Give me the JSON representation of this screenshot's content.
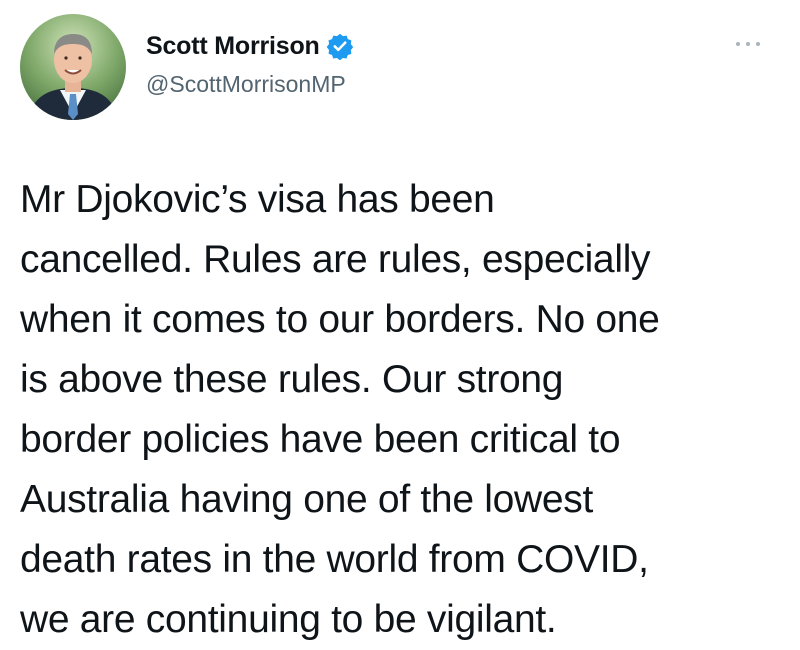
{
  "author": {
    "display_name": "Scott Morrison",
    "handle": "@ScottMorrisonMP",
    "verified_icon": "verified-badge-icon",
    "verified_color": "#1d9bf0"
  },
  "tweet": {
    "lines": [
      "Mr Djokovic’s visa has been",
      "cancelled. Rules are rules, especially",
      "when it comes to our borders. No one",
      "is above these rules. Our strong",
      "border policies have been critical to",
      "Australia having one of the lowest",
      "death rates in the world from COVID,",
      "we are continuing to be vigilant."
    ]
  },
  "more_menu_icon": "more-options-icon"
}
